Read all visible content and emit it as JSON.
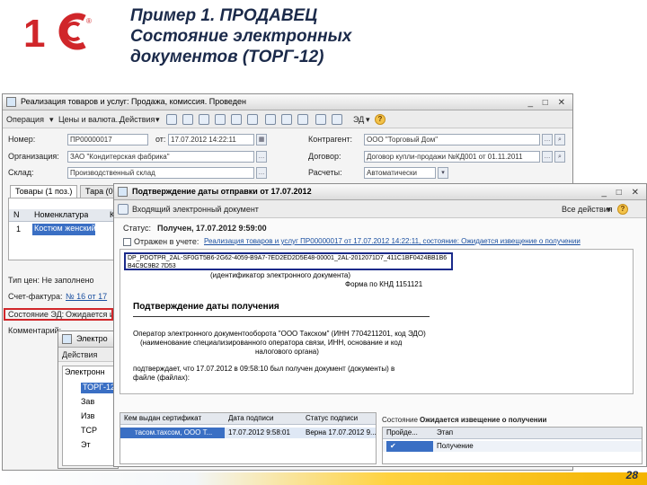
{
  "slide": {
    "title_line1": "Пример 1. ПРОДАВЕЦ",
    "title_line2": "Состояние электронных",
    "title_line3": "документов (ТОРГ-12)",
    "page_number": "28",
    "logo_colors": {
      "red": "#d0262a"
    }
  },
  "main_window": {
    "title": "Реализация товаров и услуг: Продажа, комиссия. Проведен",
    "toolbar": {
      "operation_label": "Операция",
      "prices_label": "Цены и валюта...",
      "actions_label": "Действия",
      "edo_label": "ЭД"
    },
    "fields": {
      "number_label": "Номер:",
      "number_value": "ПР00000017",
      "from_label": "от:",
      "from_value": "17.07.2012 14:22:11",
      "organization_label": "Организация:",
      "organization_value": "ЗАО \"Кондитерская фабрика\"",
      "warehouse_label": "Склад:",
      "warehouse_value": "Производственный склад",
      "counterparty_label": "Контрагент:",
      "counterparty_value": "ООО \"Торговый Дом\"",
      "contract_label": "Договор:",
      "contract_value": "Договор купли-продажи №КД001 от 01.11.2011",
      "settlements_label": "Расчеты:",
      "settlements_value": "Автоматически"
    },
    "tabs": [
      "Товары (1 поз.)",
      "Тара (0)"
    ],
    "table": {
      "headers": [
        "N",
        "Номенклатура",
        "К"
      ],
      "rows": [
        {
          "n": "1",
          "name": "Костюм женский"
        }
      ]
    },
    "bottom": {
      "price_type": "Тип цен: Не заполнено",
      "invoice_label": "Счет-фактура:",
      "invoice_value": "№ 16 от 17",
      "edo_status_label": "Состояние ЭД:",
      "edo_status_value": "Ожидается из",
      "comment_label": "Комментарий:"
    }
  },
  "confirm_window": {
    "title": "Подтверждение даты отправки от 17.07.2012",
    "inner_title": "Входящий электронный документ",
    "more_label": "Все действия",
    "status_label": "Статус:",
    "status_value": "Получен, 17.07.2012 9:59:00",
    "show_in_accounting": "Отражен в учете:",
    "doc_link": "Реализация товаров и услуг ПР00000017 от 17.07.2012 14:22:11, состояние: Ожидается извещение о получении",
    "file_id": "DP_PDOTPR_2AL-SF0GT5B6-2G62-4059-B9A7-7ED2ED2D5E48-00001_2AL-2012071D7_411C1BF0424BB1B6B4C9C9B2 7D53",
    "id_caption": "(идентификатор электронного документа)",
    "form_caption": "Форма по КНД 1151121",
    "doc_heading": "Подтверждение даты получения",
    "operator_line": "Оператор электронного документооборота \"ООО Такском\" (ИНН 7704211201, код ЭДО)",
    "operator_caption": "(наименование специализированного оператора связи, ИНН, основание и код",
    "tax_org": "налогового органа)",
    "confirm_line": "подтверждает, что 17.07.2012 в 09:58:10 был получен документ (документы) в",
    "file_label": "файле (файлах):",
    "signatures": {
      "headers": [
        "Кем выдан сертификат",
        "Дата подписи",
        "Статус подписи"
      ],
      "row": {
        "issuer": "тасом.тахсом, ООО Т...",
        "date": "17.07.2012 9:58:01",
        "status": "Верна 17.07.2012 9..."
      }
    },
    "state": {
      "label": "Состояние",
      "value": "Ожидается извещение о получении",
      "headers": [
        "Пройде...",
        "Этап"
      ],
      "rows": [
        {
          "check": "✔",
          "stage": "Получение"
        }
      ]
    }
  },
  "journal_window": {
    "title": "Электро",
    "action": "Действия",
    "header": "Электронн",
    "rows": [
      "ТОРГ-12",
      "Зав",
      "Изв",
      "ТСР",
      "Эт"
    ]
  }
}
